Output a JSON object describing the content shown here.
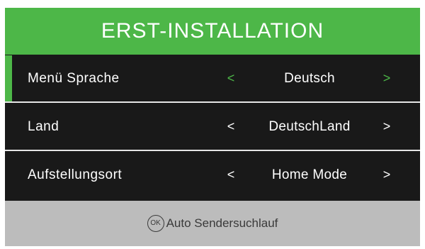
{
  "header": {
    "title": "ERST-INSTALLATION"
  },
  "rows": [
    {
      "label": "Menü Sprache",
      "value": "Deutsch",
      "left_arrow": "<",
      "right_arrow": ">",
      "focused": true
    },
    {
      "label": "Land",
      "value": "DeutschLand",
      "left_arrow": "<",
      "right_arrow": ">",
      "focused": false
    },
    {
      "label": "Aufstellungsort",
      "value": "Home Mode",
      "left_arrow": "<",
      "right_arrow": ">",
      "focused": false
    }
  ],
  "footer": {
    "ok_icon_text": "OK",
    "action_label": "Auto Sendersuchlauf"
  },
  "colors": {
    "accent": "#4db748",
    "panel_background": "#191919",
    "footer_background": "#bcbcbc",
    "text": "#ffffff"
  },
  "icons": {
    "ok_button": "ok-button-icon"
  }
}
